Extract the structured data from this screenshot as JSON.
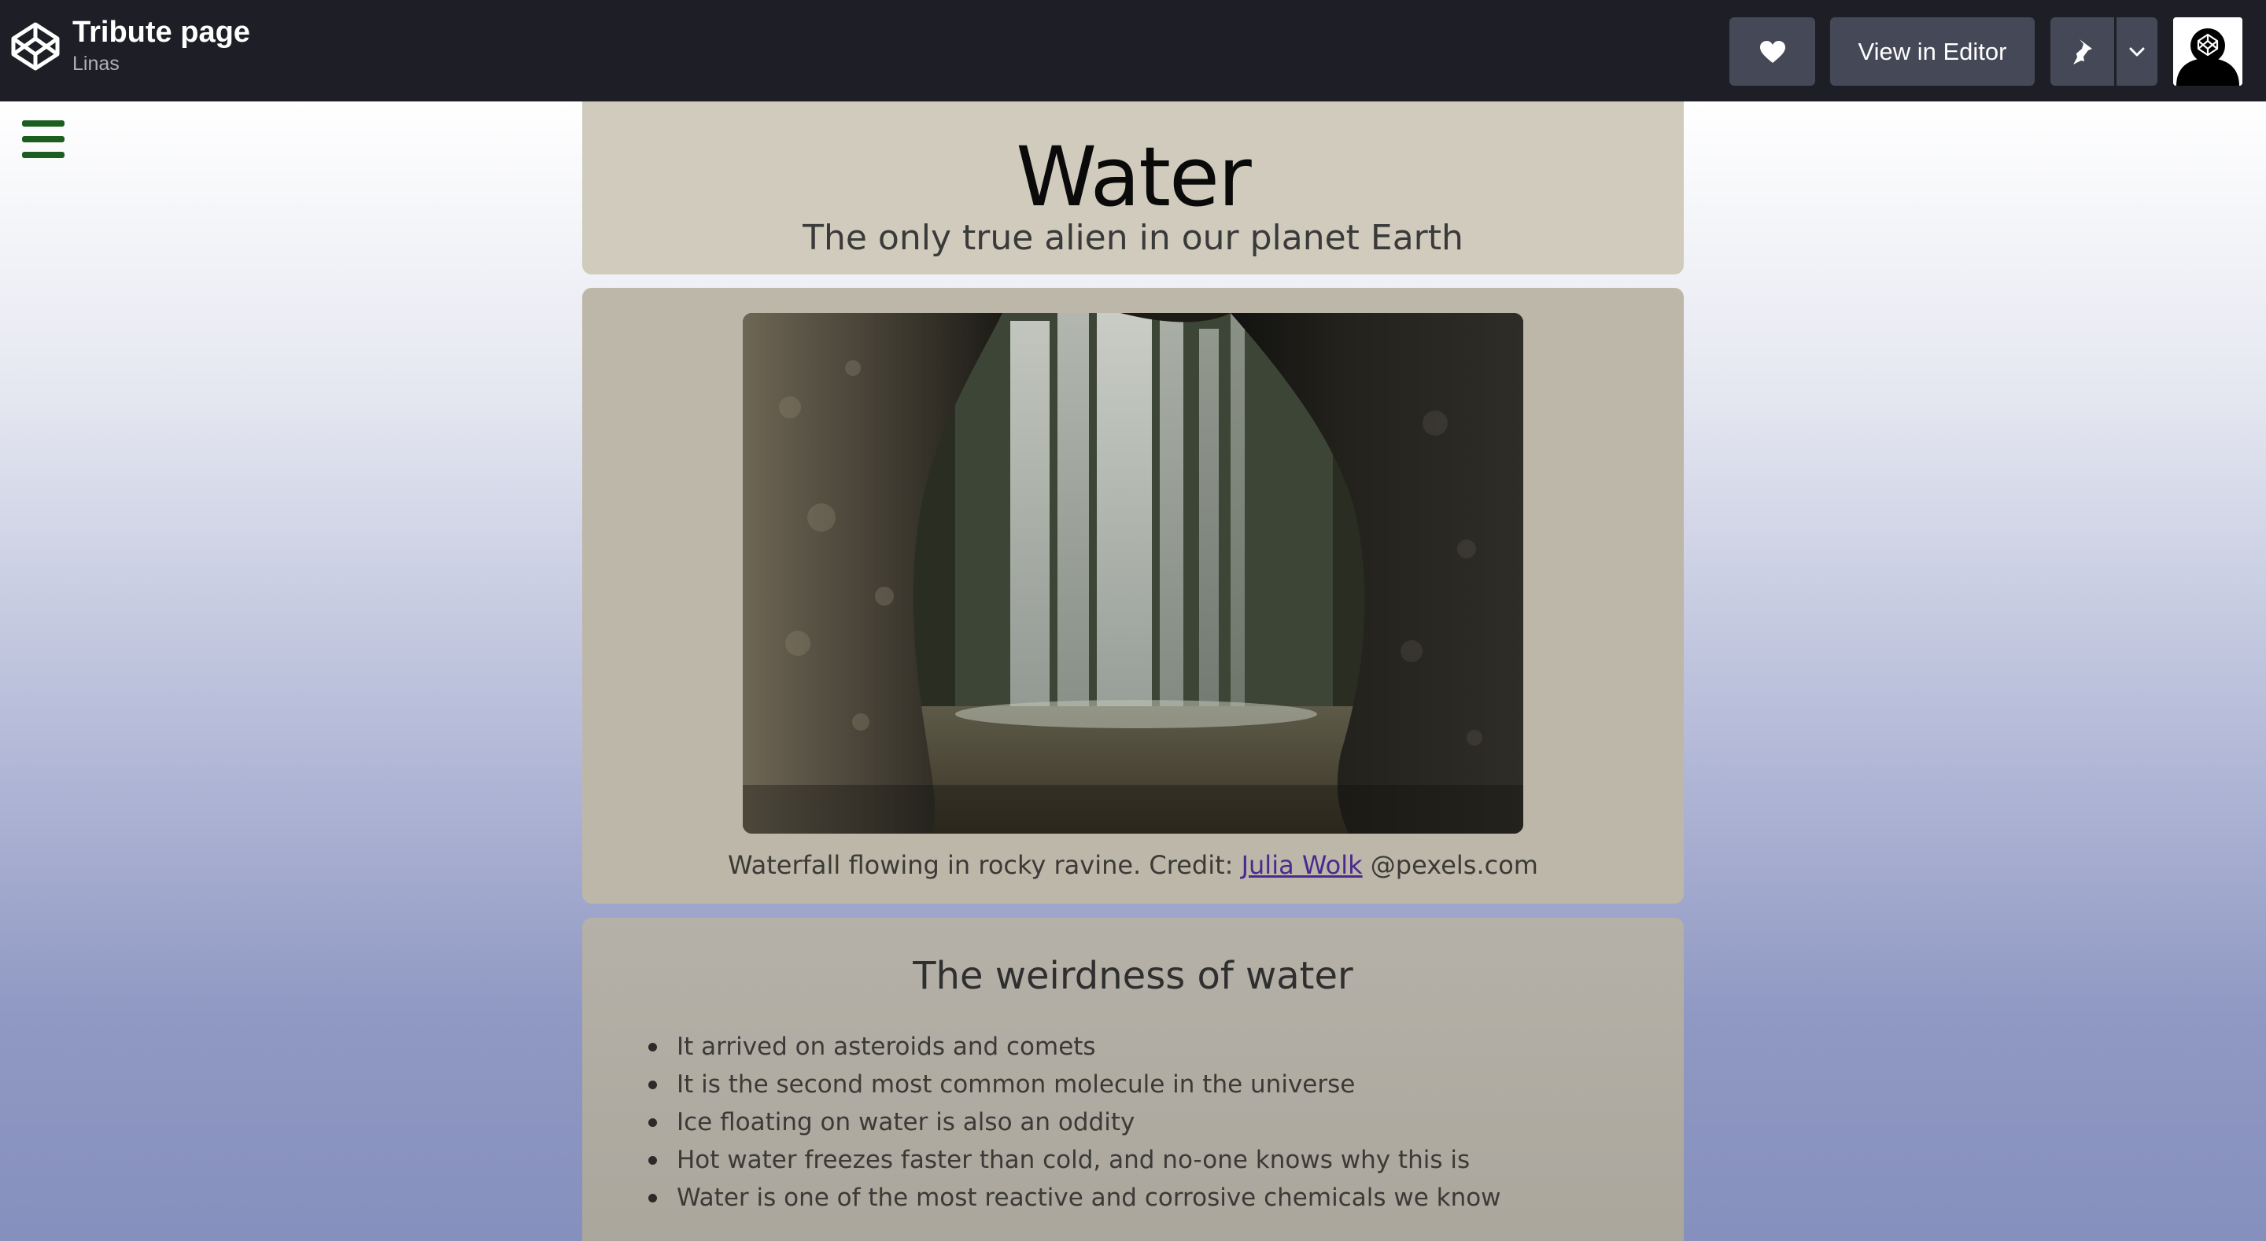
{
  "topbar": {
    "pen_title": "Tribute page",
    "author": "Linas",
    "view_in_editor_label": "View in Editor",
    "icons": {
      "logo": "codepen-logo-icon",
      "heart": "heart-icon",
      "pin": "pin-icon",
      "caret": "chevron-down-icon",
      "avatar": "user-avatar"
    }
  },
  "main": {
    "menu_icon": "hamburger-menu-icon",
    "title": "Water",
    "subtitle": "The only true alien in our planet Earth",
    "image": {
      "description": "waterfall-photo",
      "caption_prefix": "Waterfall flowing in rocky ravine. Credit: ",
      "credit_link": "Julia Wolk",
      "caption_suffix": " @pexels.com"
    },
    "facts": {
      "heading": "The weirdness of water",
      "items": [
        "It arrived on asteroids and comets",
        "It is the second most common molecule in the universe",
        "Ice floating on water is also an oddity",
        "Hot water freezes faster than cold, and no-one knows why this is",
        "Water is one of the most reactive and corrosive chemicals we know"
      ]
    }
  },
  "colors": {
    "topbar_bg": "#1e1f26",
    "button_bg": "#444857",
    "card_header": "#d0cbbd",
    "menu_green": "#1b5e20",
    "link": "#4b2a8f"
  }
}
